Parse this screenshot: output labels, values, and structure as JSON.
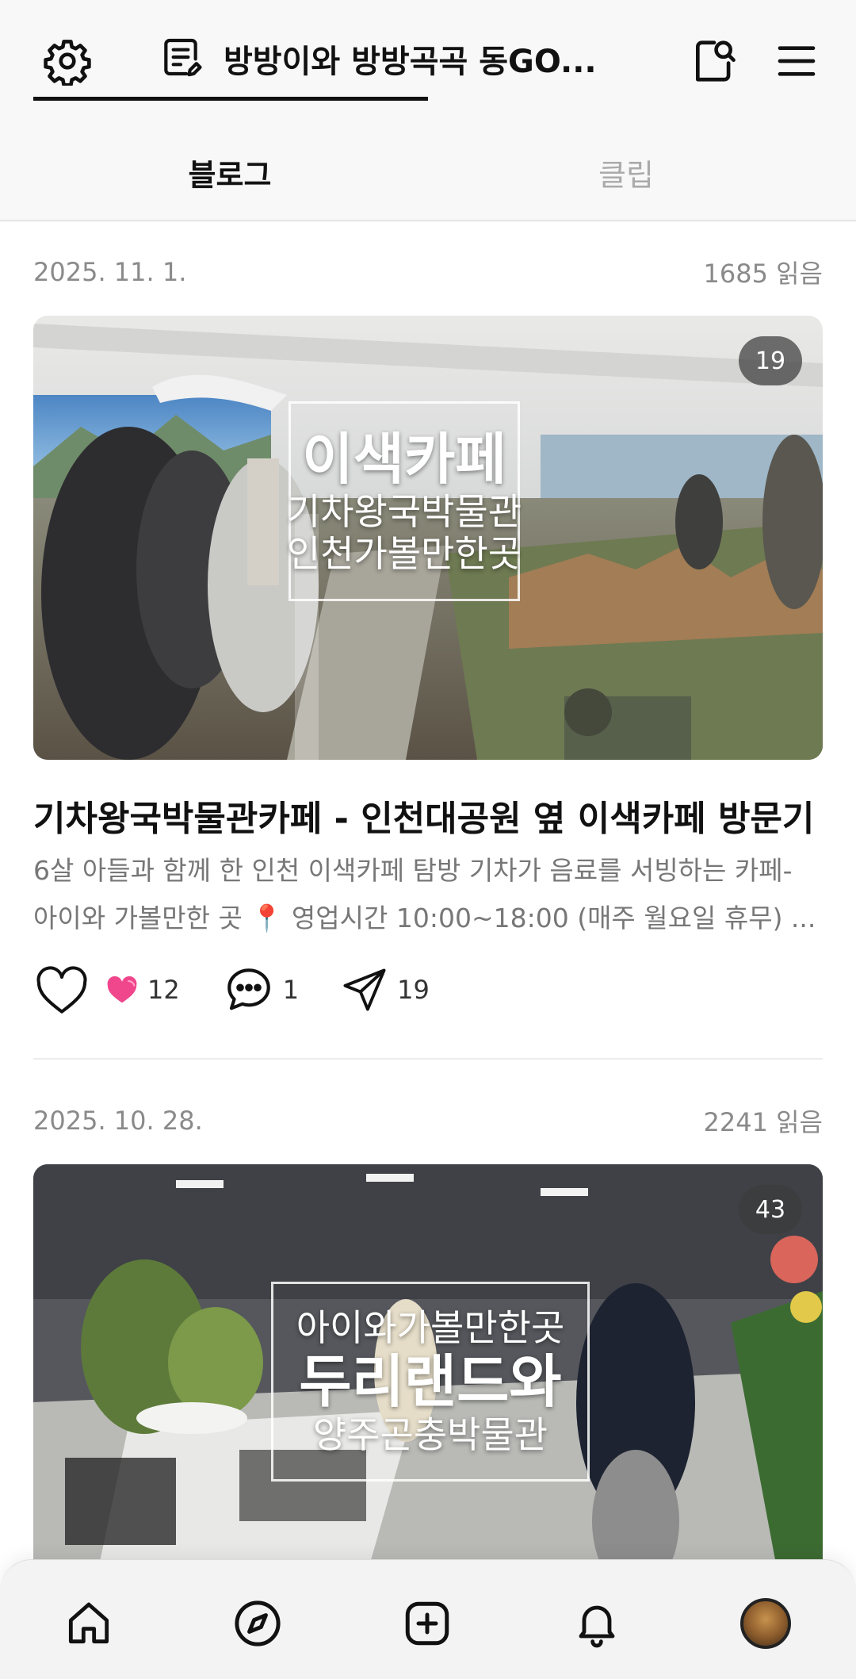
{
  "header": {
    "title": "방방이와 방방곡곡 동GO...",
    "settings_icon": "gear-icon",
    "blog_icon": "document-edit-icon",
    "search_icon": "bookmark-search-icon",
    "menu_icon": "hamburger-icon"
  },
  "tabs": [
    {
      "label": "블로그",
      "active": true
    },
    {
      "label": "클립",
      "active": false
    }
  ],
  "posts": [
    {
      "date": "2025. 11. 1.",
      "reads": "1685 읽음",
      "image_count": "19",
      "overlay_lines": [
        "이색카페",
        "기차왕국박물관",
        "인천가볼만한곳"
      ],
      "title": "기차왕국박물관카페 - 인천대공원 옆 이색카페 방문기",
      "desc_line1": "6살 아들과 함께 한 인천 이색카페 탐방 기차가 음료를 서빙하는 카페-",
      "desc_line2": "아이와 가볼만한 곳 📍 영업시간 10:00~18:00 (매주 월요일 휴무) ...",
      "like_count": "12",
      "comment_count": "1",
      "share_count": "19"
    },
    {
      "date": "2025. 10. 28.",
      "reads": "2241 읽음",
      "image_count": "43",
      "overlay_lines": [
        "아이와가볼만한곳",
        "두리랜드와",
        "양주곤충박물관"
      ]
    }
  ],
  "bottom_nav": [
    "home-icon",
    "compass-icon",
    "add-icon",
    "bell-icon",
    "profile-avatar"
  ],
  "colors": {
    "accent_like": "#f0468c",
    "tab_active": "#111111",
    "tab_inactive": "#aaaaaa"
  }
}
